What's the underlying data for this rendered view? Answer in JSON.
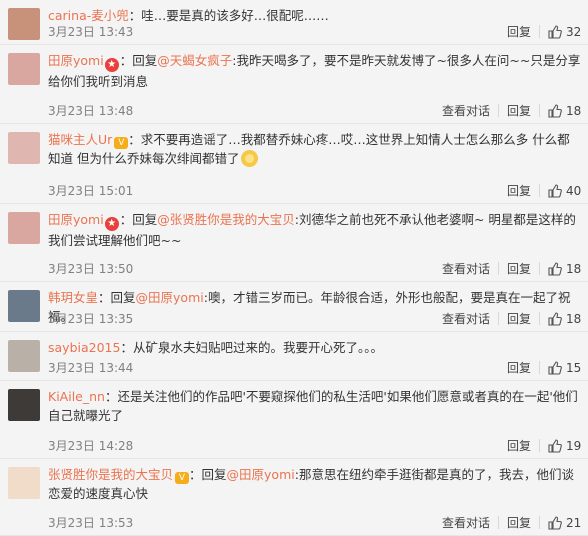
{
  "comments": [
    {
      "user": "carina-麦小兜",
      "has_badge": false,
      "has_vip": false,
      "reply_prefix": "",
      "mention": "",
      "text": "：哇…要是真的该多好…很配呢……",
      "emoji": false,
      "text2": "",
      "time": "3月23日 13:43",
      "show_convo": false,
      "convo_label": "",
      "reply_label": "回复",
      "likes": "32",
      "height": 45,
      "avatar_color": "#c8927a"
    },
    {
      "user": "田原yomi",
      "has_badge": true,
      "has_vip": false,
      "reply_prefix": "：回复",
      "mention": "@天蝎女疯子",
      "text": ":我昨天喝多了，要不是昨天就发博了~很多人在问~~只是分享给你们我听到消息",
      "emoji": false,
      "text2": "",
      "time": "3月23日 13:48",
      "show_convo": true,
      "convo_label": "查看对话",
      "reply_label": "回复",
      "likes": "18",
      "height": 79,
      "avatar_color": "#d9a6a0"
    },
    {
      "user": "猫咪主人Ur",
      "has_badge": false,
      "has_vip": true,
      "reply_prefix": "",
      "mention": "",
      "text": "：求不要再造谣了…我都替乔妹心疼…哎…这世界上知情人士怎么那么多 什么都知道 但为什么乔妹每次绯闻都错了",
      "emoji": true,
      "text2": "",
      "time": "3月23日 15:01",
      "show_convo": false,
      "convo_label": "",
      "reply_label": "回复",
      "likes": "40",
      "height": 80,
      "avatar_color": "#e0b7b0"
    },
    {
      "user": "田原yomi",
      "has_badge": true,
      "has_vip": false,
      "reply_prefix": "：回复",
      "mention": "@张贤胜你是我的大宝贝",
      "text": ":刘德华之前也死不承认他老婆啊~ 明星都是这样的 我们尝试理解他们吧~~",
      "emoji": false,
      "text2": "",
      "time": "3月23日 13:50",
      "show_convo": true,
      "convo_label": "查看对话",
      "reply_label": "回复",
      "likes": "18",
      "height": 78,
      "avatar_color": "#d9a6a0"
    },
    {
      "user": "韩玥女皇",
      "has_badge": false,
      "has_vip": false,
      "reply_prefix": "：回复",
      "mention": "@田原yomi",
      "text": ":噢，才错三岁而已。年龄很合适，外形也般配，要是真在一起了祝福。",
      "emoji": false,
      "text2": "",
      "time": "3月23日 13:35",
      "show_convo": true,
      "convo_label": "查看对话",
      "reply_label": "回复",
      "likes": "18",
      "height": 50,
      "avatar_color": "#6b7a8a"
    },
    {
      "user": "saybia2015",
      "has_badge": false,
      "has_vip": false,
      "reply_prefix": "",
      "mention": "",
      "text": "：从矿泉水夫妇贴吧过来的。我要开心死了。。。",
      "emoji": false,
      "text2": "",
      "time": "3月23日 13:44",
      "show_convo": false,
      "convo_label": "",
      "reply_label": "回复",
      "likes": "15",
      "height": 49,
      "avatar_color": "#b9b0a8"
    },
    {
      "user": "KiAile_nn",
      "has_badge": false,
      "has_vip": false,
      "reply_prefix": "",
      "mention": "",
      "text": "：还是关注他们的作品吧'不要窥探他们的私生活吧'如果他们愿意或者真的在一起'他们自己就曝光了",
      "emoji": false,
      "text2": "",
      "time": "3月23日 14:28",
      "show_convo": false,
      "convo_label": "",
      "reply_label": "回复",
      "likes": "19",
      "height": 78,
      "avatar_color": "#3d3a38"
    },
    {
      "user": "张贤胜你是我的大宝贝",
      "has_badge": false,
      "has_vip": true,
      "reply_prefix": "：回复",
      "mention": "@田原yomi",
      "text": ":那意思在纽约牵手逛街都是真的了，我去，他们谈恋爱的速度真心快",
      "emoji": false,
      "text2": "",
      "time": "3月23日 13:53",
      "show_convo": true,
      "convo_label": "查看对话",
      "reply_label": "回复",
      "likes": "21",
      "height": 77,
      "avatar_color": "#f0dcc8"
    }
  ],
  "colors": {
    "username": "#eb7350",
    "text": "#333333",
    "meta": "#808080",
    "background": "#f4f4f4"
  }
}
